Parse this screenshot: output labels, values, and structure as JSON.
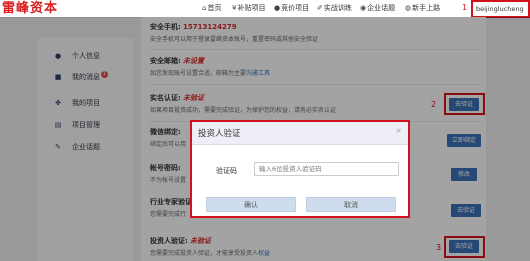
{
  "brand": {
    "name": "雷峰资本"
  },
  "nav": [
    {
      "icon": "home-icon",
      "glyph": "⌂",
      "label": "首页"
    },
    {
      "icon": "subsidy-icon",
      "glyph": "¥",
      "label": "补贴项目"
    },
    {
      "icon": "bid-icon",
      "glyph": "●",
      "label": "竞价项目"
    },
    {
      "icon": "training-icon",
      "glyph": "✐",
      "label": "实战训练"
    },
    {
      "icon": "enterprise-icon",
      "glyph": "◉",
      "label": "企业话题"
    },
    {
      "icon": "newbie-icon",
      "glyph": "◍",
      "label": "新手上路"
    }
  ],
  "user": {
    "name": "beijinglucheng",
    "caret": "▾"
  },
  "annotations": [
    "1",
    "2",
    "3"
  ],
  "sidebar": {
    "items": [
      {
        "icon": "user-icon",
        "glyph": "●",
        "label": "个人信息"
      },
      {
        "icon": "message-icon",
        "glyph": "■",
        "label": "我的消息",
        "badge": "1"
      },
      {
        "icon": "project-icon",
        "glyph": "✤",
        "label": "我的项目"
      },
      {
        "icon": "manage-icon",
        "glyph": "▤",
        "label": "项目管理"
      },
      {
        "icon": "topic-icon",
        "glyph": "✎",
        "label": "企业话题"
      }
    ]
  },
  "sections": {
    "phone": {
      "title": "安全手机:",
      "value": "15713124279",
      "desc": "安全手机可以用于登录雷峰资本账号，重置密码或其他安全验证"
    },
    "email": {
      "title": "安全邮箱:",
      "status": "未设置",
      "desc": "如您发现账号设置合适，邮箱为主要",
      "link": "沟通工具"
    },
    "realname": {
      "title": "实名认证:",
      "status": "未验证",
      "desc": "如果项目投资成功，需要完成验证，为保护您的权益，请务必实名认证",
      "button": "去验证"
    },
    "wechat": {
      "title": "微信绑定:",
      "desc": "绑定后可以用",
      "button": "立即绑定"
    },
    "password": {
      "title": "帐号密码:",
      "desc": "不为帐号设置",
      "button": "修改"
    },
    "expert": {
      "title": "行业专家验证",
      "desc": "您需要完成行",
      "button": "去验证"
    },
    "investor": {
      "title": "投资人验证:",
      "status": "未验证",
      "desc": "您需要完成投资人验证，才能享受投资人",
      "link": "权益",
      "button": "去验证"
    }
  },
  "modal": {
    "title": "投资人验证",
    "close": "×",
    "field_label": "验证码",
    "placeholder": "输入6位投资人验证码",
    "ok": "确认",
    "cancel": "取消"
  }
}
